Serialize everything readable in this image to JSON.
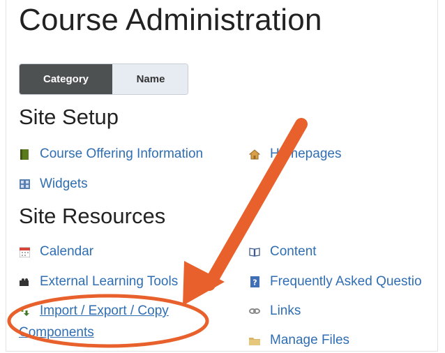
{
  "page_title": "Course Administration",
  "view_toggle": {
    "category_label": "Category",
    "name_label": "Name",
    "selected": "Category"
  },
  "sections": [
    {
      "heading": "Site Setup",
      "items": [
        {
          "label": "Course Offering Information",
          "icon": "book-icon"
        },
        {
          "label": "Homepages",
          "icon": "house-icon"
        },
        {
          "label": "Widgets",
          "icon": "widget-grid-icon"
        }
      ]
    },
    {
      "heading": "Site Resources",
      "items": [
        {
          "label": "Calendar",
          "icon": "calendar-icon"
        },
        {
          "label": "Content",
          "icon": "open-book-icon"
        },
        {
          "label": "External Learning Tools",
          "icon": "puzzle-icon"
        },
        {
          "label": "Frequently Asked Questio",
          "icon": "faq-icon"
        },
        {
          "label": "Import / Export / Copy",
          "label_line2": "Components",
          "icon": "import-arrows-icon"
        },
        {
          "label": "Links",
          "icon": "chain-link-icon"
        },
        {
          "label": "Manage Files",
          "icon": "folder-icon"
        }
      ]
    }
  ],
  "annotation": {
    "arrow_color": "#e8612c",
    "circle_color": "#e8612c"
  },
  "colors": {
    "link": "#2f6eb2",
    "toggle_active": "#4e5152",
    "toggle_inactive": "#e7ecf2"
  }
}
